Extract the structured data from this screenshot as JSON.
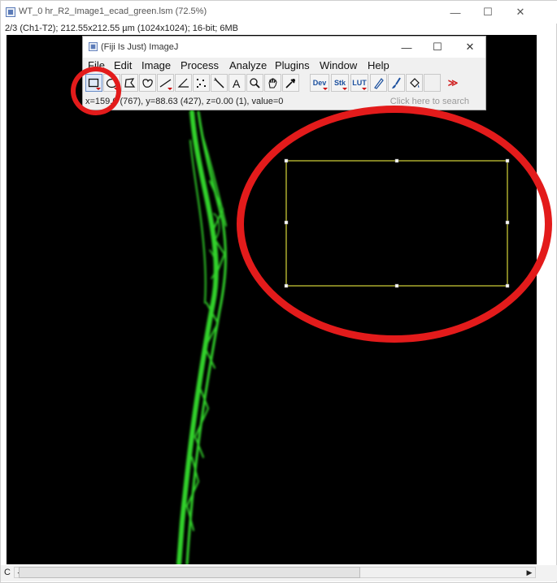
{
  "outer_window": {
    "title": "WT_0 hr_R2_Image1_ecad_green.lsm (72.5%)",
    "info": "2/3 (Ch1-T2); 212.55x212.55 µm (1024x1024); 16-bit; 6MB",
    "scroll_label": "C",
    "controls": {
      "minimize": "—",
      "maximize": "☐",
      "close": "✕"
    }
  },
  "imagej": {
    "title": "(Fiji Is Just) ImageJ",
    "controls": {
      "minimize": "—",
      "maximize": "☐",
      "close": "✕"
    },
    "menu": [
      "File",
      "Edit",
      "Image",
      "Process",
      "Analyze",
      "Plugins",
      "Window",
      "Help"
    ],
    "tools": [
      "rectangle",
      "oval",
      "polygon",
      "freehand",
      "line",
      "angle",
      "multi-point",
      "wand",
      "text",
      "magnifier",
      "hand",
      "color-picker",
      "Dev",
      "Stk",
      "LUT",
      "pencil",
      "brush",
      "flood-fill",
      "more"
    ],
    "tool_labels": {
      "dev": "Dev",
      "stk": "Stk",
      "lut": "LUT",
      "more": "≫"
    },
    "status": "x=159.0 (767), y=88.63 (427), z=0.00 (1), value=0",
    "search_placeholder": "Click here to search"
  },
  "colors": {
    "canvas": "#000000",
    "signal": "#32d22c",
    "roi": "#d6d63a",
    "annotation": "#e31b1b"
  }
}
